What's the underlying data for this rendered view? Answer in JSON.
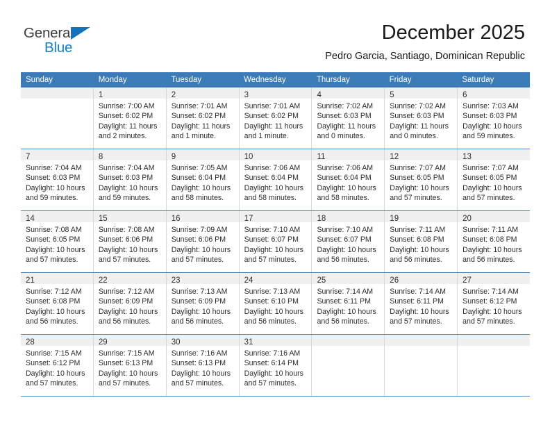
{
  "brand": {
    "name_part1": "General",
    "name_part2": "Blue",
    "accent_color": "#1581cd",
    "triangle_color": "#1373ba"
  },
  "header": {
    "title": "December 2025",
    "subtitle": "Pedro Garcia, Santiago, Dominican Republic"
  },
  "calendar": {
    "header_bg": "#3b7cb8",
    "weekdays": [
      "Sunday",
      "Monday",
      "Tuesday",
      "Wednesday",
      "Thursday",
      "Friday",
      "Saturday"
    ],
    "weeks": [
      [
        {
          "day": "",
          "lines": []
        },
        {
          "day": "1",
          "lines": [
            "Sunrise: 7:00 AM",
            "Sunset: 6:02 PM",
            "Daylight: 11 hours",
            "and 2 minutes."
          ]
        },
        {
          "day": "2",
          "lines": [
            "Sunrise: 7:01 AM",
            "Sunset: 6:02 PM",
            "Daylight: 11 hours",
            "and 1 minute."
          ]
        },
        {
          "day": "3",
          "lines": [
            "Sunrise: 7:01 AM",
            "Sunset: 6:02 PM",
            "Daylight: 11 hours",
            "and 1 minute."
          ]
        },
        {
          "day": "4",
          "lines": [
            "Sunrise: 7:02 AM",
            "Sunset: 6:03 PM",
            "Daylight: 11 hours",
            "and 0 minutes."
          ]
        },
        {
          "day": "5",
          "lines": [
            "Sunrise: 7:02 AM",
            "Sunset: 6:03 PM",
            "Daylight: 11 hours",
            "and 0 minutes."
          ]
        },
        {
          "day": "6",
          "lines": [
            "Sunrise: 7:03 AM",
            "Sunset: 6:03 PM",
            "Daylight: 10 hours",
            "and 59 minutes."
          ]
        }
      ],
      [
        {
          "day": "7",
          "lines": [
            "Sunrise: 7:04 AM",
            "Sunset: 6:03 PM",
            "Daylight: 10 hours",
            "and 59 minutes."
          ]
        },
        {
          "day": "8",
          "lines": [
            "Sunrise: 7:04 AM",
            "Sunset: 6:03 PM",
            "Daylight: 10 hours",
            "and 59 minutes."
          ]
        },
        {
          "day": "9",
          "lines": [
            "Sunrise: 7:05 AM",
            "Sunset: 6:04 PM",
            "Daylight: 10 hours",
            "and 58 minutes."
          ]
        },
        {
          "day": "10",
          "lines": [
            "Sunrise: 7:06 AM",
            "Sunset: 6:04 PM",
            "Daylight: 10 hours",
            "and 58 minutes."
          ]
        },
        {
          "day": "11",
          "lines": [
            "Sunrise: 7:06 AM",
            "Sunset: 6:04 PM",
            "Daylight: 10 hours",
            "and 58 minutes."
          ]
        },
        {
          "day": "12",
          "lines": [
            "Sunrise: 7:07 AM",
            "Sunset: 6:05 PM",
            "Daylight: 10 hours",
            "and 57 minutes."
          ]
        },
        {
          "day": "13",
          "lines": [
            "Sunrise: 7:07 AM",
            "Sunset: 6:05 PM",
            "Daylight: 10 hours",
            "and 57 minutes."
          ]
        }
      ],
      [
        {
          "day": "14",
          "lines": [
            "Sunrise: 7:08 AM",
            "Sunset: 6:05 PM",
            "Daylight: 10 hours",
            "and 57 minutes."
          ]
        },
        {
          "day": "15",
          "lines": [
            "Sunrise: 7:08 AM",
            "Sunset: 6:06 PM",
            "Daylight: 10 hours",
            "and 57 minutes."
          ]
        },
        {
          "day": "16",
          "lines": [
            "Sunrise: 7:09 AM",
            "Sunset: 6:06 PM",
            "Daylight: 10 hours",
            "and 57 minutes."
          ]
        },
        {
          "day": "17",
          "lines": [
            "Sunrise: 7:10 AM",
            "Sunset: 6:07 PM",
            "Daylight: 10 hours",
            "and 57 minutes."
          ]
        },
        {
          "day": "18",
          "lines": [
            "Sunrise: 7:10 AM",
            "Sunset: 6:07 PM",
            "Daylight: 10 hours",
            "and 56 minutes."
          ]
        },
        {
          "day": "19",
          "lines": [
            "Sunrise: 7:11 AM",
            "Sunset: 6:08 PM",
            "Daylight: 10 hours",
            "and 56 minutes."
          ]
        },
        {
          "day": "20",
          "lines": [
            "Sunrise: 7:11 AM",
            "Sunset: 6:08 PM",
            "Daylight: 10 hours",
            "and 56 minutes."
          ]
        }
      ],
      [
        {
          "day": "21",
          "lines": [
            "Sunrise: 7:12 AM",
            "Sunset: 6:08 PM",
            "Daylight: 10 hours",
            "and 56 minutes."
          ]
        },
        {
          "day": "22",
          "lines": [
            "Sunrise: 7:12 AM",
            "Sunset: 6:09 PM",
            "Daylight: 10 hours",
            "and 56 minutes."
          ]
        },
        {
          "day": "23",
          "lines": [
            "Sunrise: 7:13 AM",
            "Sunset: 6:09 PM",
            "Daylight: 10 hours",
            "and 56 minutes."
          ]
        },
        {
          "day": "24",
          "lines": [
            "Sunrise: 7:13 AM",
            "Sunset: 6:10 PM",
            "Daylight: 10 hours",
            "and 56 minutes."
          ]
        },
        {
          "day": "25",
          "lines": [
            "Sunrise: 7:14 AM",
            "Sunset: 6:11 PM",
            "Daylight: 10 hours",
            "and 56 minutes."
          ]
        },
        {
          "day": "26",
          "lines": [
            "Sunrise: 7:14 AM",
            "Sunset: 6:11 PM",
            "Daylight: 10 hours",
            "and 57 minutes."
          ]
        },
        {
          "day": "27",
          "lines": [
            "Sunrise: 7:14 AM",
            "Sunset: 6:12 PM",
            "Daylight: 10 hours",
            "and 57 minutes."
          ]
        }
      ],
      [
        {
          "day": "28",
          "lines": [
            "Sunrise: 7:15 AM",
            "Sunset: 6:12 PM",
            "Daylight: 10 hours",
            "and 57 minutes."
          ]
        },
        {
          "day": "29",
          "lines": [
            "Sunrise: 7:15 AM",
            "Sunset: 6:13 PM",
            "Daylight: 10 hours",
            "and 57 minutes."
          ]
        },
        {
          "day": "30",
          "lines": [
            "Sunrise: 7:16 AM",
            "Sunset: 6:13 PM",
            "Daylight: 10 hours",
            "and 57 minutes."
          ]
        },
        {
          "day": "31",
          "lines": [
            "Sunrise: 7:16 AM",
            "Sunset: 6:14 PM",
            "Daylight: 10 hours",
            "and 57 minutes."
          ]
        },
        {
          "day": "",
          "lines": []
        },
        {
          "day": "",
          "lines": []
        },
        {
          "day": "",
          "lines": []
        }
      ]
    ]
  }
}
